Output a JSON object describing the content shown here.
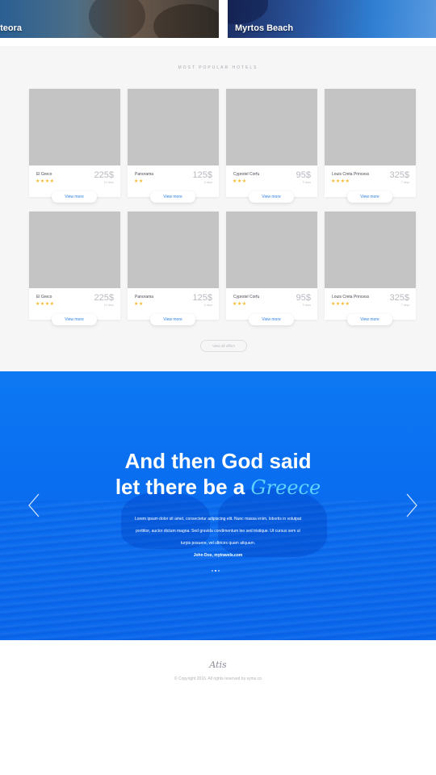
{
  "destinations": [
    {
      "label": "eteora"
    },
    {
      "label": "Myrtos Beach"
    }
  ],
  "hotels_section": {
    "title": "MOST POPULAR HOTELS",
    "view_all_label": "View all offers",
    "cards": [
      {
        "name": "El Greco",
        "stars": "★★★★",
        "price": "225$",
        "duration": "10 days",
        "button": "View more"
      },
      {
        "name": "Panorama",
        "stars": "★★",
        "price": "125$",
        "duration": "6 days",
        "button": "View more"
      },
      {
        "name": "Cyprotel Corfu",
        "stars": "★★★",
        "price": "95$",
        "duration": "5 days",
        "button": "View more"
      },
      {
        "name": "Louis Creta Princess",
        "stars": "★★★★",
        "price": "325$",
        "duration": "7 days",
        "button": "View more"
      },
      {
        "name": "El Greco",
        "stars": "★★★★",
        "price": "225$",
        "duration": "10 days",
        "button": "View more"
      },
      {
        "name": "Panorama",
        "stars": "★★",
        "price": "125$",
        "duration": "6 days",
        "button": "View more"
      },
      {
        "name": "Cyprotel Corfu",
        "stars": "★★★",
        "price": "95$",
        "duration": "5 days",
        "button": "View more"
      },
      {
        "name": "Louis Creta Princess",
        "stars": "★★★★",
        "price": "325$",
        "duration": "7 days",
        "button": "View more"
      }
    ]
  },
  "hero": {
    "headline_line1": "And then God said",
    "headline_line2_prefix": "let there be a",
    "headline_script": "Greece",
    "quote_lines": [
      "Lorem ipsum dolor sit amet, consectetur adipiscing elit. Nunc massa enim, lobortis in volutpat",
      "porttitor, auctor dictum magna. Sed gravida condimentum leo sed tristique. Ut cursus sem ut",
      "turpis posuere, vel ultrices quam aliquam."
    ],
    "author": "John Doe, mytravels.com",
    "slides_count": 3,
    "left_arrow_icon": "chevron-left-icon",
    "right_arrow_icon": "chevron-right-icon"
  },
  "footer": {
    "logo": "Atis",
    "copyright": "© Copyright 2016. All rights reserved by symu.co"
  },
  "colors": {
    "accent_blue": "#0a6ef0",
    "star": "#f5b82e",
    "button_text": "#2d7fe0"
  }
}
